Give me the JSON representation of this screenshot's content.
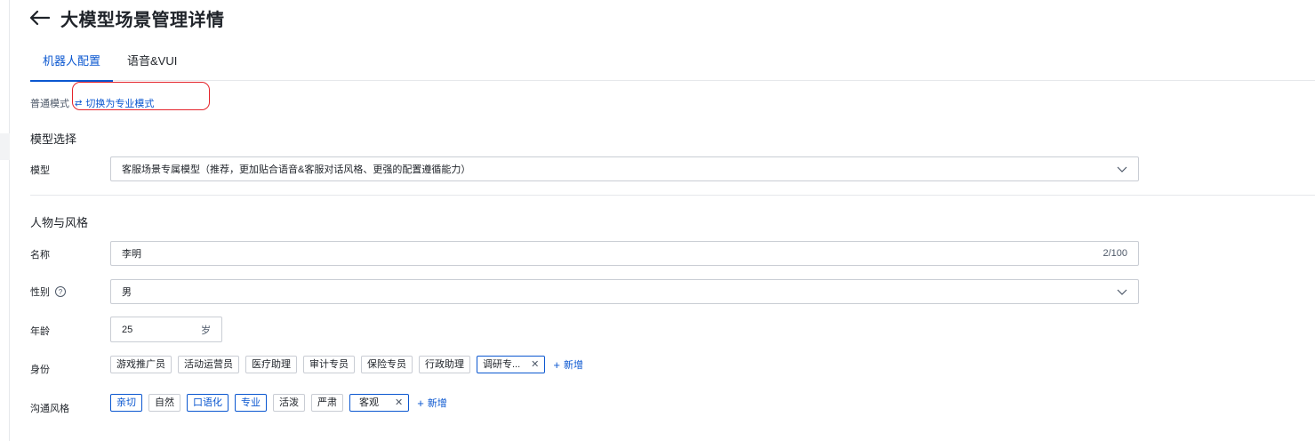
{
  "header": {
    "title": "大模型场景管理详情"
  },
  "tabs": [
    {
      "label": "机器人配置"
    },
    {
      "label": "语音&VUI"
    }
  ],
  "mode": {
    "current": "普通模式",
    "switch_label": "切换为专业模式"
  },
  "model_section": {
    "title": "模型选择",
    "model_label": "模型",
    "model_value": "客服场景专属模型（推荐，更加贴合语音&客服对话风格、更强的配置遵循能力）"
  },
  "persona_section": {
    "title": "人物与风格",
    "name_label": "名称",
    "name_value": "李明",
    "name_count": "2/100",
    "gender_label": "性别",
    "gender_value": "男",
    "age_label": "年龄",
    "age_value": "25",
    "age_unit": "岁",
    "identity_label": "身份",
    "identity_tags": [
      "游戏推广员",
      "活动运营员",
      "医疗助理",
      "审计专员",
      "保险专员",
      "行政助理"
    ],
    "identity_selected": "调研专...",
    "add_label": "新增",
    "style_label": "沟通风格",
    "style_tags": [
      "亲切",
      "自然",
      "口语化",
      "专业",
      "活泼",
      "严肃"
    ],
    "style_selected": "客观"
  },
  "colors": {
    "accent": "#0b57d0",
    "highlight": "#e5242b"
  }
}
